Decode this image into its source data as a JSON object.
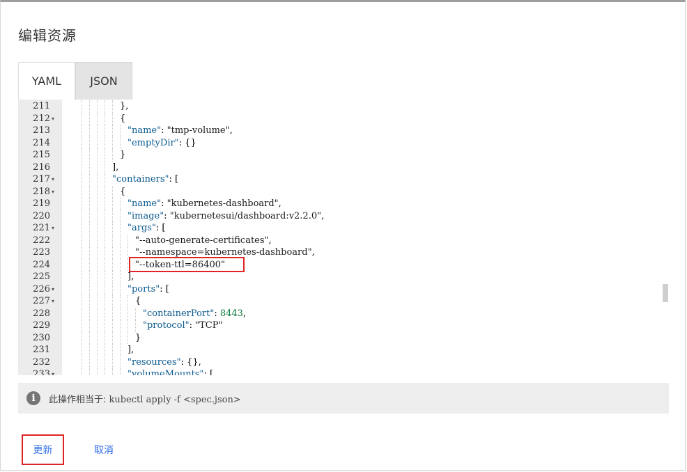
{
  "dialog": {
    "title": "编辑资源",
    "tabs": [
      {
        "label": "YAML",
        "active": true
      },
      {
        "label": "JSON",
        "active": false
      }
    ]
  },
  "editor": {
    "lines": [
      {
        "n": "211",
        "fold": "",
        "indent": 6,
        "html": "},"
      },
      {
        "n": "212",
        "fold": "▾",
        "indent": 6,
        "html": "{"
      },
      {
        "n": "213",
        "fold": "",
        "indent": 7,
        "html": "<span class=\"k\">\"name\"</span>: <span class=\"s\">\"tmp-volume\"</span>,"
      },
      {
        "n": "214",
        "fold": "",
        "indent": 7,
        "html": "<span class=\"k\">\"emptyDir\"</span>: {}"
      },
      {
        "n": "215",
        "fold": "",
        "indent": 6,
        "html": "}"
      },
      {
        "n": "216",
        "fold": "",
        "indent": 5,
        "html": "],"
      },
      {
        "n": "217",
        "fold": "▾",
        "indent": 5,
        "html": "<span class=\"k\">\"containers\"</span>: ["
      },
      {
        "n": "218",
        "fold": "▾",
        "indent": 6,
        "html": "{"
      },
      {
        "n": "219",
        "fold": "",
        "indent": 7,
        "html": "<span class=\"k\">\"name\"</span>: <span class=\"s\">\"kubernetes-dashboard\"</span>,"
      },
      {
        "n": "220",
        "fold": "",
        "indent": 7,
        "html": "<span class=\"k\">\"image\"</span>: <span class=\"s\">\"kubernetesui/dashboard:v2.2.0\"</span>,"
      },
      {
        "n": "221",
        "fold": "▾",
        "indent": 7,
        "html": "<span class=\"k\">\"args\"</span>: ["
      },
      {
        "n": "222",
        "fold": "",
        "indent": 8,
        "html": "<span class=\"s\">\"--auto-generate-certificates\"</span>,"
      },
      {
        "n": "223",
        "fold": "",
        "indent": 8,
        "html": "<span class=\"s\">\"--namespace=kubernetes-dashboard\"</span>,"
      },
      {
        "n": "224",
        "fold": "",
        "indent": 8,
        "html": "<span class=\"s\">\"--token-ttl=86400\"</span>"
      },
      {
        "n": "225",
        "fold": "",
        "indent": 7,
        "html": "],"
      },
      {
        "n": "226",
        "fold": "▾",
        "indent": 7,
        "html": "<span class=\"k\">\"ports\"</span>: ["
      },
      {
        "n": "227",
        "fold": "▾",
        "indent": 8,
        "html": "{"
      },
      {
        "n": "228",
        "fold": "",
        "indent": 9,
        "html": "<span class=\"k\">\"containerPort\"</span>: <span class=\"num\">8443</span>,"
      },
      {
        "n": "229",
        "fold": "",
        "indent": 9,
        "html": "<span class=\"k\">\"protocol\"</span>: <span class=\"s\">\"TCP\"</span>"
      },
      {
        "n": "230",
        "fold": "",
        "indent": 8,
        "html": "}"
      },
      {
        "n": "231",
        "fold": "",
        "indent": 7,
        "html": "],"
      },
      {
        "n": "232",
        "fold": "",
        "indent": 7,
        "html": "<span class=\"k\">\"resources\"</span>: {},"
      },
      {
        "n": "233",
        "fold": "▾",
        "indent": 7,
        "html": "<span class=\"k\">\"volumeMounts\"</span>: ["
      }
    ]
  },
  "info": {
    "prefix": "此操作相当于: ",
    "command": "kubectl apply -f <spec.json>"
  },
  "actions": {
    "update_label": "更新",
    "cancel_label": "取消"
  },
  "colors": {
    "accent": "#326de6",
    "highlight": "#e02424"
  }
}
